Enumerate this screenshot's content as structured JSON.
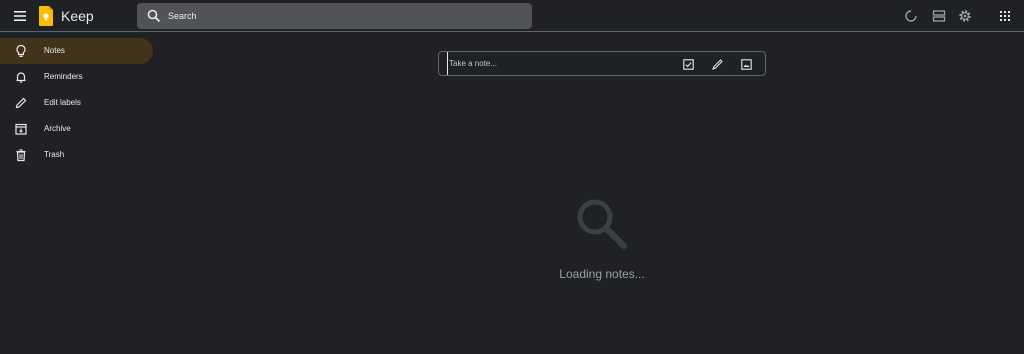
{
  "header": {
    "app_title": "Keep",
    "menu_icon": "hamburger-menu-icon",
    "logo_icon": "keep-logo-icon",
    "logo_color": "#fbbc04",
    "search": {
      "placeholder": "Search",
      "icon": "search-icon"
    },
    "actions": [
      "refresh-icon",
      "list-view-icon",
      "settings-icon",
      "apps-grid-icon"
    ]
  },
  "sidebar": {
    "items": [
      {
        "label": "Notes",
        "icon": "lightbulb-icon",
        "active": true
      },
      {
        "label": "Reminders",
        "icon": "bell-icon",
        "active": false
      },
      {
        "label": "Edit labels",
        "icon": "pencil-icon",
        "active": false
      },
      {
        "label": "Archive",
        "icon": "archive-icon",
        "active": false
      },
      {
        "label": "Trash",
        "icon": "trash-icon",
        "active": false
      }
    ],
    "active_color": "#41331c"
  },
  "take_note": {
    "placeholder": "Take a note...",
    "actions": [
      "checkbox-icon",
      "brush-icon",
      "image-icon"
    ]
  },
  "main": {
    "status_text": "Loading notes...",
    "status_icon": "magnifier-icon"
  },
  "colors": {
    "background": "#202124",
    "search_bg": "#525355",
    "text": "#e8eaed",
    "muted_text": "#9aa0a6"
  }
}
